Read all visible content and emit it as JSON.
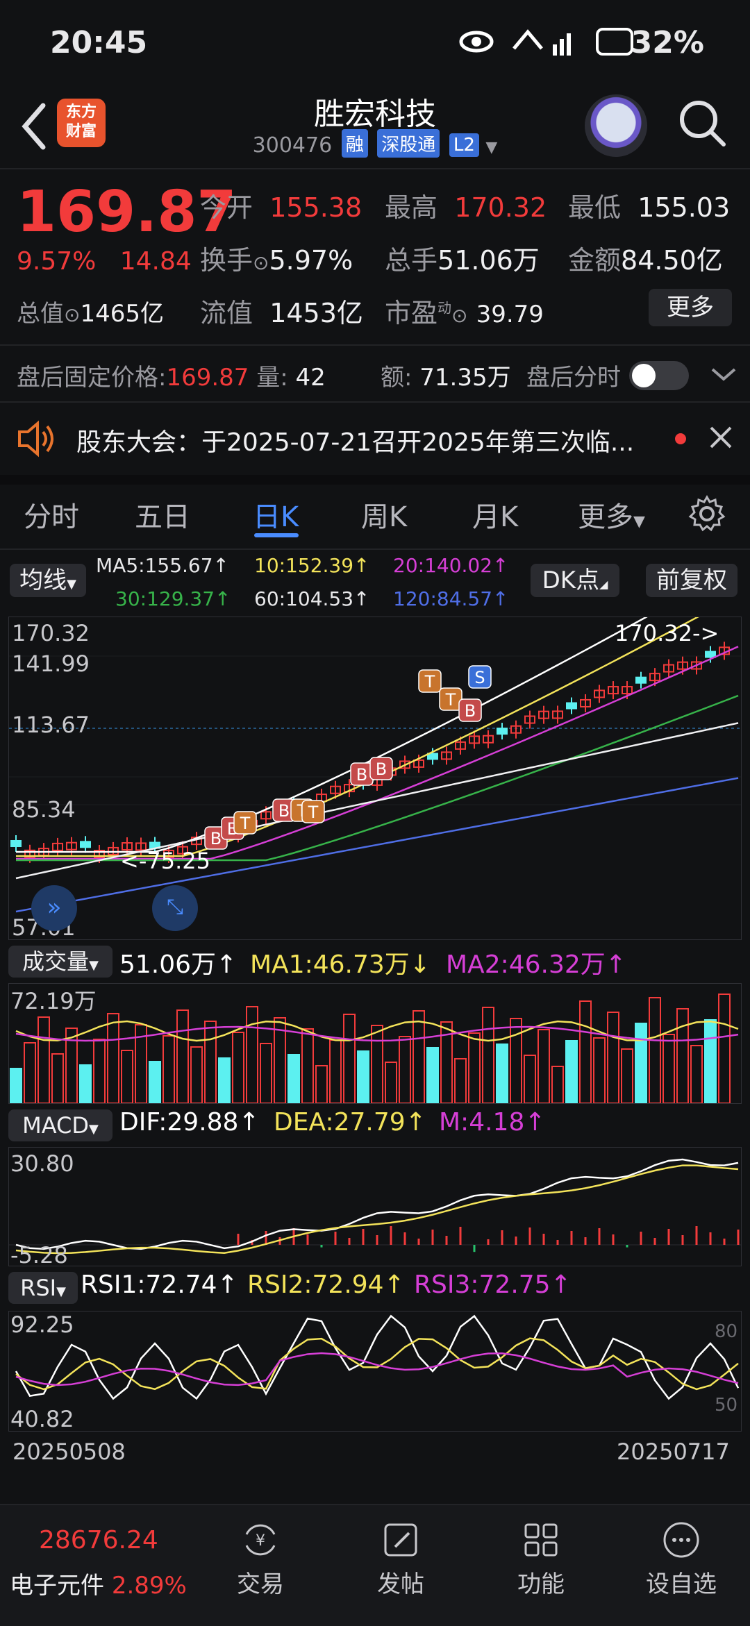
{
  "status_bar": {
    "time": "20:45",
    "network": "4G",
    "battery": "32%"
  },
  "header": {
    "app_badge": [
      "东方",
      "财富"
    ],
    "stock_name": "胜宏科技",
    "stock_code": "300476",
    "tags": [
      "融",
      "深股通",
      "L2"
    ]
  },
  "quote": {
    "price": "169.87",
    "change_pct": "9.57%",
    "change_abs": "14.84",
    "fields": [
      {
        "label": "今开",
        "value": "155.38",
        "color": "red"
      },
      {
        "label": "最高",
        "value": "170.32",
        "color": "red"
      },
      {
        "label": "最低",
        "value": "155.03",
        "color": "white"
      },
      {
        "label": "换手",
        "value": "5.97%",
        "color": "white"
      },
      {
        "label": "总手",
        "value": "51.06万",
        "color": "white"
      },
      {
        "label": "金额",
        "value": "84.50亿",
        "color": "white"
      },
      {
        "label": "总值",
        "value": "1465亿",
        "color": "white"
      },
      {
        "label": "流值",
        "value": "1453亿",
        "color": "white"
      },
      {
        "label": "市盈",
        "superscript": "动",
        "value": "39.79",
        "color": "white"
      }
    ],
    "more_label": "更多"
  },
  "after_hours": {
    "price_label": "盘后固定价格:",
    "price": "169.87",
    "volume_label": "量:",
    "volume": "42",
    "amount_label": "额:",
    "amount": "71.35万",
    "toggle_label": "盘后分时",
    "toggle_on": false
  },
  "notice": {
    "text": "股东大会：于2025-07-21召开2025年第三次临..."
  },
  "tabs": {
    "items": [
      "分时",
      "五日",
      "日K",
      "周K",
      "月K",
      "更多"
    ],
    "active": "日K"
  },
  "ma_bar": {
    "selector": "均线",
    "ma": [
      {
        "label": "MA5:155.67↑",
        "color": "#ffffff"
      },
      {
        "label": "10:152.39↑",
        "color": "#f3e35a"
      },
      {
        "label": "20:140.02↑",
        "color": "#d63fd6"
      },
      {
        "label": "30:129.37↑",
        "color": "#37b34a"
      },
      {
        "label": "60:104.53↑",
        "color": "#ffffff"
      },
      {
        "label": "120:84.57↑",
        "color": "#4f6ee6"
      }
    ],
    "dk_label": "DK点",
    "adjust_label": "前复权"
  },
  "kline": {
    "y_labels": [
      "170.32",
      "141.99",
      "113.67",
      "85.34",
      "57.01"
    ],
    "high_marker": "170.32->",
    "low_marker": "<-75.25",
    "signals": [
      "B",
      "B",
      "T",
      "B",
      "T",
      "T",
      "B",
      "B",
      "T",
      "T",
      "B",
      "S"
    ]
  },
  "volume": {
    "selector": "成交量",
    "value": "51.06万↑",
    "ma1": "MA1:46.73万↓",
    "ma2": "MA2:46.32万↑",
    "y_label": "72.19万"
  },
  "macd": {
    "selector": "MACD",
    "dif": "DIF:29.88↑",
    "dea": "DEA:27.79↑",
    "m": "M:4.18↑",
    "y_top": "30.80",
    "y_bottom": "-5.28"
  },
  "rsi": {
    "selector": "RSI",
    "rsi1": "RSI1:72.74↑",
    "rsi2": "RSI2:72.94↑",
    "rsi3": "RSI3:72.75↑",
    "y_top": "92.25",
    "y_bottom": "40.82",
    "ref_80": "80",
    "ref_50": "50"
  },
  "dates": {
    "start": "20250508",
    "end": "20250717"
  },
  "bottom_nav": {
    "index_value": "28676.24",
    "index_name": "电子元件",
    "index_change": "2.89%",
    "items": [
      "交易",
      "发帖",
      "功能",
      "设自选"
    ]
  },
  "colors": {
    "up": "#f23b3b",
    "down": "#5cf0f0",
    "accent": "#4a8cff"
  }
}
